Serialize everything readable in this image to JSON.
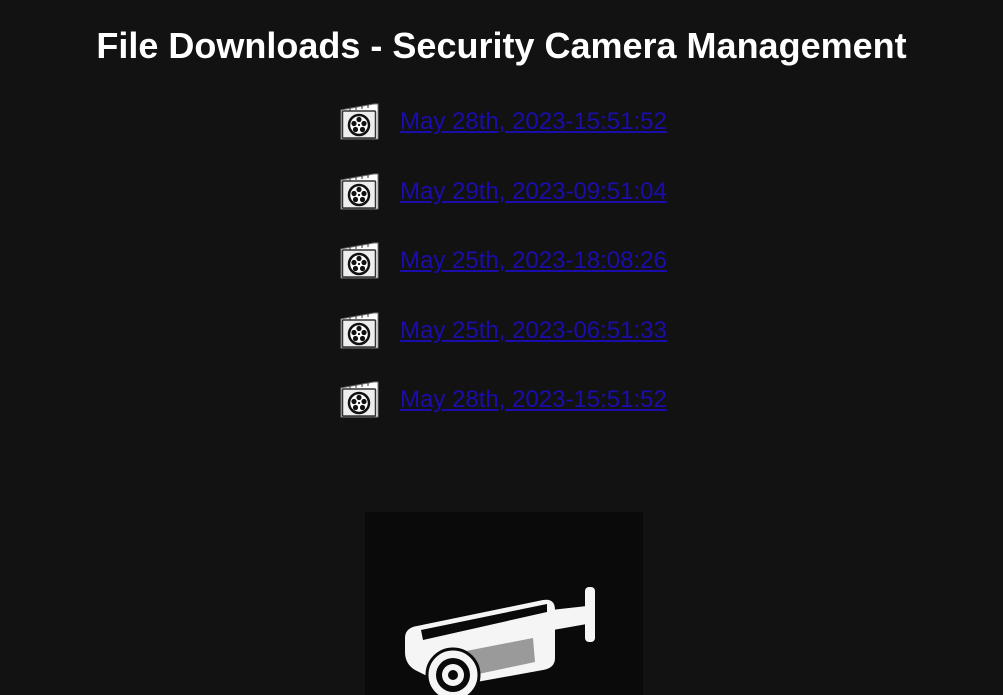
{
  "page": {
    "title": "File Downloads - Security Camera Management"
  },
  "files": [
    {
      "label": "May 28th, 2023-15:51:52",
      "icon": "video-file-icon"
    },
    {
      "label": "May 29th, 2023-09:51:04",
      "icon": "video-file-icon"
    },
    {
      "label": "May 25th, 2023-18:08:26",
      "icon": "video-file-icon"
    },
    {
      "label": "May 25th, 2023-06:51:33",
      "icon": "video-file-icon"
    },
    {
      "label": "May 28th, 2023-15:51:52",
      "icon": "video-file-icon"
    }
  ],
  "hero": {
    "icon": "security-camera-icon"
  },
  "colors": {
    "background": "#121212",
    "title_text": "#ffffff",
    "link": "#1a0dab",
    "camera_panel": "#0a0a0a"
  }
}
